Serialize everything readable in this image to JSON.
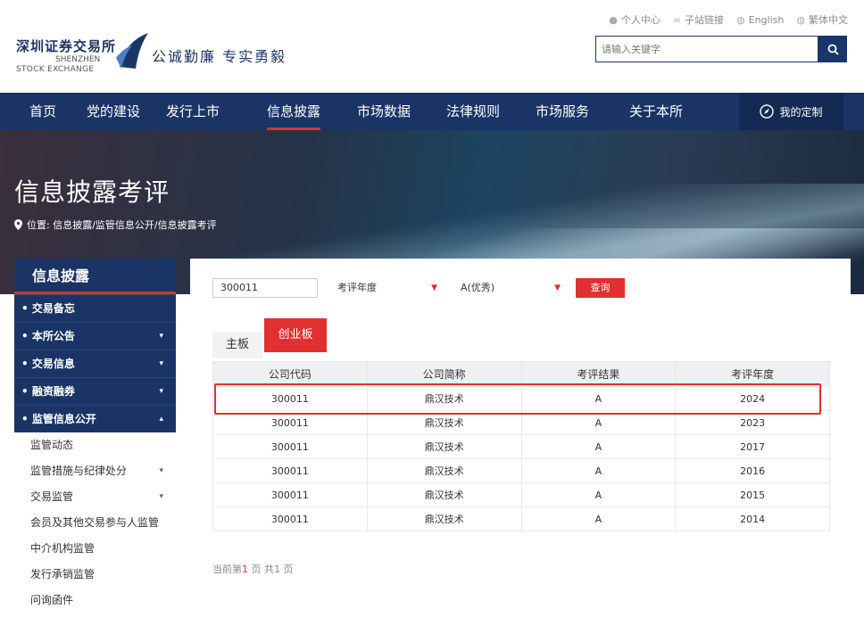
{
  "header": {
    "links": [
      {
        "icon": "user-icon",
        "label": "个人中心"
      },
      {
        "icon": "link-icon",
        "label": "子站链接"
      },
      {
        "icon": "globe-icon",
        "label": "English"
      },
      {
        "icon": "globe-icon",
        "label": "繁体中文"
      }
    ],
    "logo_cn": "深圳证券交易所",
    "logo_en_1": "SHENZHEN",
    "logo_en_2": "STOCK EXCHANGE",
    "slogan": "公诚勤廉 专实勇毅",
    "search_placeholder": "请输入关键字"
  },
  "nav": {
    "items": [
      "首页",
      "党的建设",
      "发行上市",
      "信息披露",
      "市场数据",
      "法律规则",
      "市场服务",
      "关于本所"
    ],
    "active": "信息披露",
    "custom_label": "我的定制"
  },
  "banner": {
    "title": "信息披露考评",
    "breadcrumb": "位置: 信息披露/监管信息公开/信息披露考评"
  },
  "sidebar": {
    "heading": "信息披露",
    "items": [
      {
        "label": "• 交易备忘",
        "arrow": ""
      },
      {
        "label": "• 本所公告",
        "arrow": "▾"
      },
      {
        "label": "• 交易信息",
        "arrow": "▾"
      },
      {
        "label": "• 融资融券",
        "arrow": "▾"
      },
      {
        "label": "• 监管信息公开",
        "arrow": "▴"
      }
    ],
    "subitems": [
      {
        "label": "监管动态",
        "arrow": ""
      },
      {
        "label": "监管措施与纪律处分",
        "arrow": "▾"
      },
      {
        "label": "交易监管",
        "arrow": "▾"
      },
      {
        "label": "会员及其他交易参与人监管",
        "arrow": ""
      },
      {
        "label": "中介机构监管",
        "arrow": ""
      },
      {
        "label": "发行承销监管",
        "arrow": ""
      },
      {
        "label": "问询函件",
        "arrow": ""
      }
    ]
  },
  "filters": {
    "code_value": "300011",
    "year_placeholder": "考评年度",
    "result_value": "A(优秀)",
    "query_label": "查询"
  },
  "tabs": {
    "main": "主板",
    "gem": "创业板"
  },
  "table": {
    "headers": [
      "公司代码",
      "公司简称",
      "考评结果",
      "考评年度"
    ],
    "rows": [
      [
        "300011",
        "鼎汉技术",
        "A",
        "2024"
      ],
      [
        "300011",
        "鼎汉技术",
        "A",
        "2023"
      ],
      [
        "300011",
        "鼎汉技术",
        "A",
        "2017"
      ],
      [
        "300011",
        "鼎汉技术",
        "A",
        "2016"
      ],
      [
        "300011",
        "鼎汉技术",
        "A",
        "2015"
      ],
      [
        "300011",
        "鼎汉技术",
        "A",
        "2014"
      ]
    ]
  },
  "pager": {
    "prefix": "当前第",
    "current": "1",
    "mid": " 页  共",
    "total": "1",
    "suffix": " 页"
  }
}
